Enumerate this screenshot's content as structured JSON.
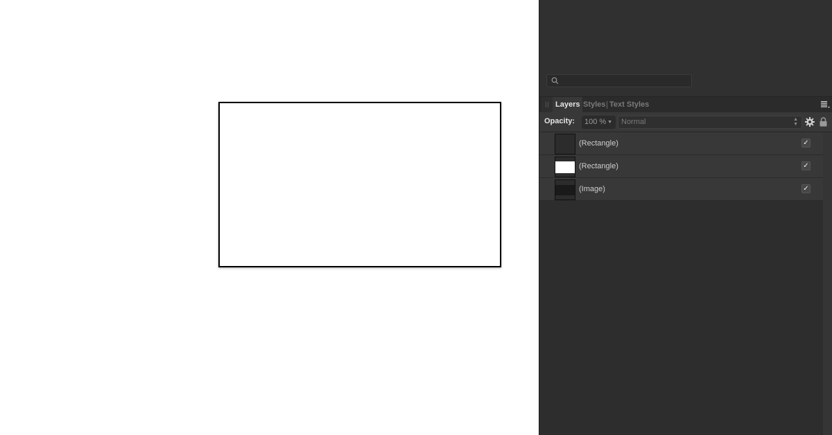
{
  "panel": {
    "search": {
      "placeholder": "",
      "value": "",
      "icon": "search-icon"
    },
    "tabs": [
      {
        "label": "Layers",
        "active": true
      },
      {
        "label": "Styles",
        "active": false
      },
      {
        "label": "Text Styles",
        "active": false
      }
    ],
    "toolbar": {
      "opacity_label": "Opacity:",
      "opacity_value": "100 %",
      "blend_mode": "Normal"
    },
    "layers": [
      {
        "name": "(Rectangle)",
        "thumbnail": "dark",
        "visible": true
      },
      {
        "name": "(Rectangle)",
        "thumbnail": "white",
        "visible": true
      },
      {
        "name": "(Image)",
        "thumbnail": "image",
        "visible": true
      }
    ],
    "check_glyph": "✓"
  },
  "colors": {
    "panel_bg": "#303030",
    "canvas_bg": "#ffffff",
    "active_tab_text": "#e6e6e6",
    "inactive_tab_text": "#7a7a7a"
  }
}
